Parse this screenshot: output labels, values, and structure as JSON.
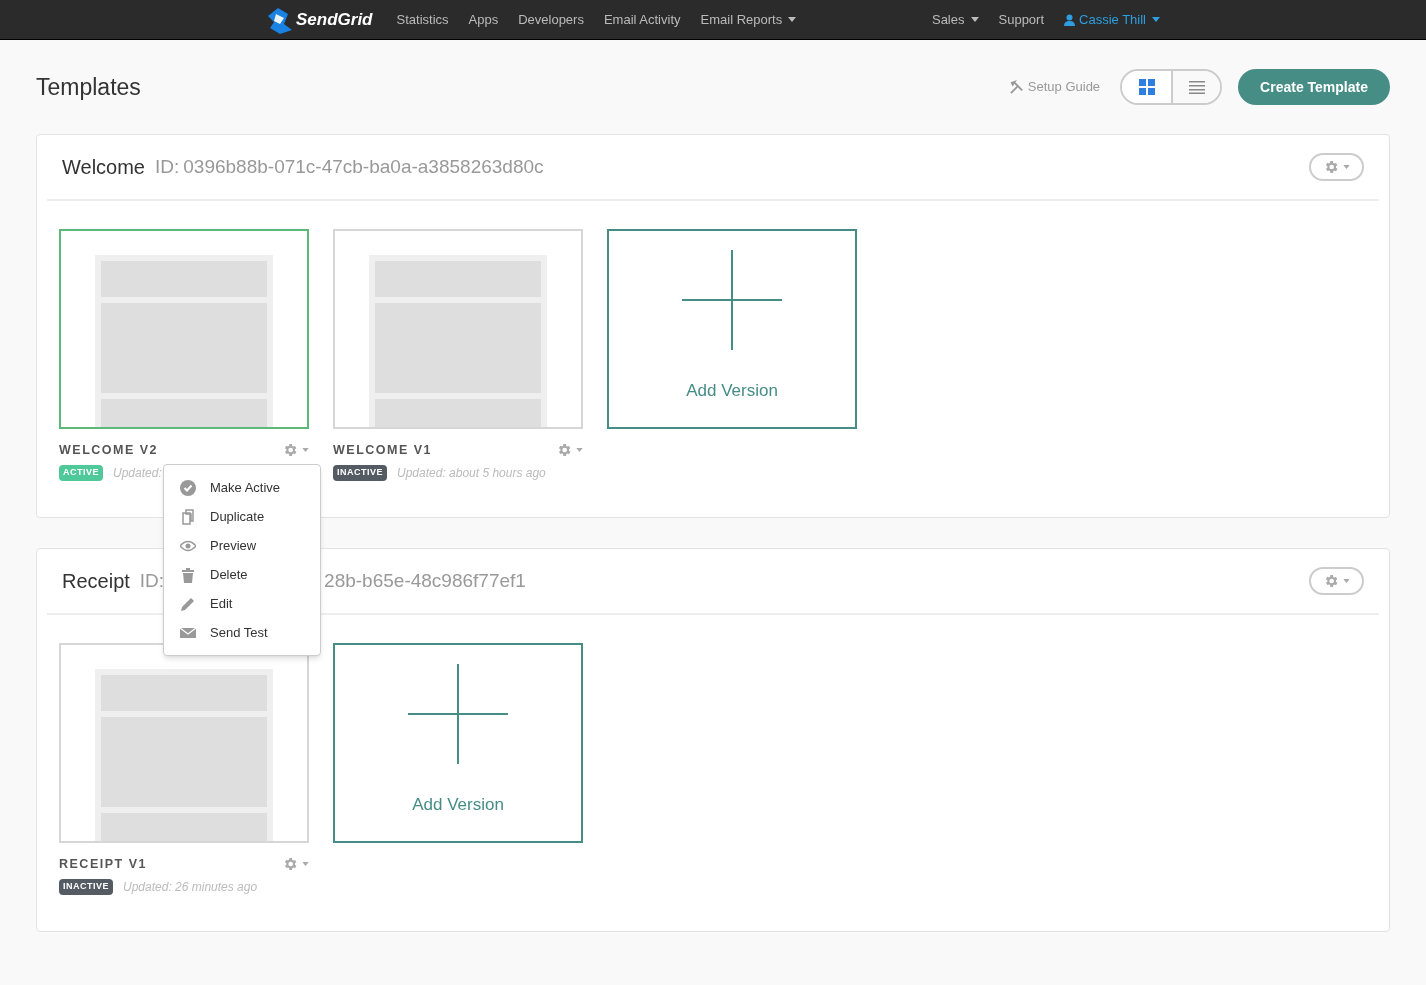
{
  "navbar": {
    "brand": "SendGrid",
    "links": [
      {
        "label": "Statistics",
        "dropdown": false
      },
      {
        "label": "Apps",
        "dropdown": false
      },
      {
        "label": "Developers",
        "dropdown": false
      },
      {
        "label": "Email Activity",
        "dropdown": false
      },
      {
        "label": "Email Reports",
        "dropdown": true
      }
    ],
    "right_links": [
      {
        "label": "Sales",
        "dropdown": true,
        "kind": "plain"
      },
      {
        "label": "Support",
        "dropdown": false,
        "kind": "plain"
      },
      {
        "label": "Cassie Thill",
        "dropdown": true,
        "kind": "user"
      }
    ]
  },
  "page": {
    "title": "Templates",
    "setup_guide": "Setup Guide",
    "view_toggle": [
      {
        "kind": "grid",
        "selected": true
      },
      {
        "kind": "list",
        "selected": false
      }
    ],
    "create_button": "Create Template"
  },
  "templates": [
    {
      "name": "Welcome",
      "id_label": "ID:",
      "id": "0396b88b-071c-47cb-ba0a-a3858263d80c",
      "id_offset": false,
      "versions": [
        {
          "name": "WELCOME V2",
          "status": "ACTIVE",
          "active": true,
          "updated": "Updated:"
        },
        {
          "name": "WELCOME V1",
          "status": "INACTIVE",
          "active": false,
          "updated": "Updated: about 5 hours ago"
        }
      ],
      "add_version": "Add Version"
    },
    {
      "name": "Receipt",
      "id_label": "ID:",
      "id": "28b-b65e-48c986f77ef1",
      "id_offset": true,
      "versions": [
        {
          "name": "RECEIPT V1",
          "status": "INACTIVE",
          "active": false,
          "updated": "Updated: 26 minutes ago"
        }
      ],
      "add_version": "Add Version"
    }
  ],
  "context_menu": {
    "items": [
      {
        "kind": "check",
        "label": "Make Active"
      },
      {
        "kind": "copy",
        "label": "Duplicate"
      },
      {
        "kind": "eye",
        "label": "Preview"
      },
      {
        "kind": "trash",
        "label": "Delete"
      },
      {
        "kind": "pencil",
        "label": "Edit"
      },
      {
        "kind": "mail",
        "label": "Send Test"
      }
    ]
  }
}
